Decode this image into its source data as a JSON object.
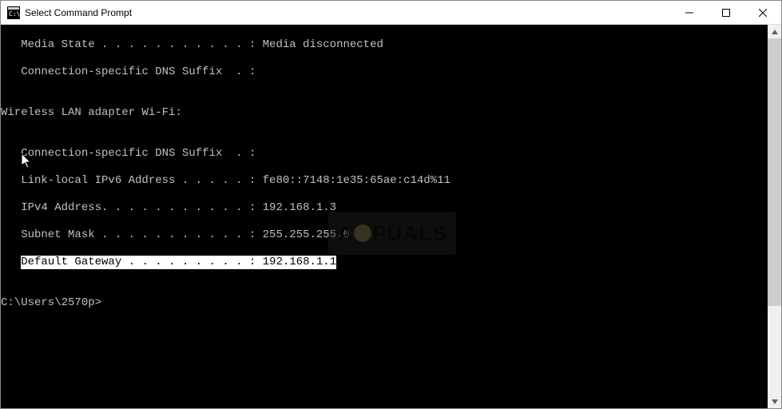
{
  "window": {
    "title": "Select Command Prompt"
  },
  "console": {
    "media_state_line": "   Media State . . . . . . . . . . . : Media disconnected",
    "dns_suffix_1": "   Connection-specific DNS Suffix  . :",
    "blank": "",
    "adapter_header": "Wireless LAN adapter Wi-Fi:",
    "dns_suffix_2": "   Connection-specific DNS Suffix  . :",
    "ipv6_line": "   Link-local IPv6 Address . . . . . : fe80::7148:1e35:65ae:c14d%11",
    "ipv4_line": "   IPv4 Address. . . . . . . . . . . : 192.168.1.3",
    "subnet_line": "   Subnet Mask . . . . . . . . . . . : 255.255.255.0",
    "gateway_prefix": "   ",
    "gateway_highlight": "Default Gateway . . . . . . . . . : 192.168.1.1",
    "prompt": "C:\\Users\\2570p>"
  },
  "watermark": {
    "text_left": "A",
    "text_right": "PUALS"
  }
}
